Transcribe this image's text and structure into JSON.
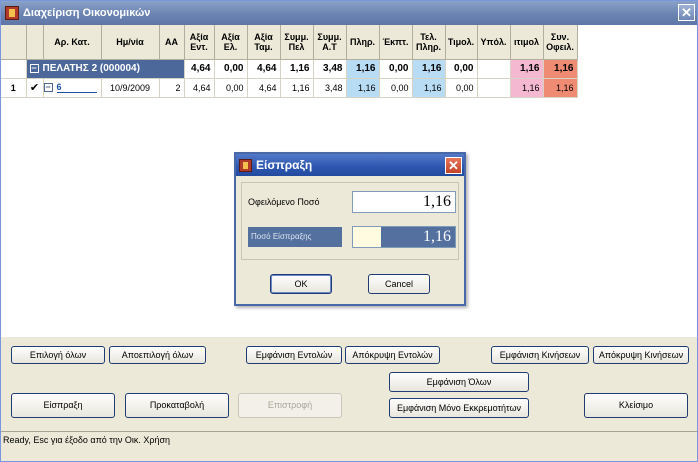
{
  "window": {
    "title": "Διαχείριση Οικονομικών",
    "close_glyph": "✕"
  },
  "grid": {
    "columns": [
      "",
      "",
      "Αρ. Κατ.",
      "Ημ/νία",
      "ΑΑ",
      "Αξία Εντ.",
      "Αξία Ελ.",
      "Αξία Ταμ.",
      "Συμμ. Πελ",
      "Συμμ. Α.Τ",
      "Πληρ.",
      "Έκπτ.",
      "Τελ. Πληρ.",
      "Τιμολ.",
      "Υπόλ.",
      "ιτιμολ",
      "Συν. Οφειλ."
    ],
    "group": {
      "label": "ΠΕΛΑΤΗΣ 2  (000004)",
      "values": [
        "4,64",
        "0,00",
        "4,64",
        "1,16",
        "3,48",
        "1,16",
        "0,00",
        "1,16",
        "0,00",
        "",
        "1,16",
        "1,16"
      ]
    },
    "rows": [
      {
        "num": "1",
        "checked": "✔",
        "code": "6",
        "date": "10/9/2009",
        "aa": "2",
        "values": [
          "4,64",
          "0,00",
          "4,64",
          "1,16",
          "3,48",
          "1,16",
          "0,00",
          "1,16",
          "0,00",
          "",
          "1,16",
          "1,16"
        ]
      }
    ]
  },
  "dialog": {
    "title": "Είσπραξη",
    "owed_label": "Οφειλόμενο Ποσό",
    "owed_value": "1,16",
    "receipt_label": "Ποσό Είσπραξης",
    "receipt_value": "1,16",
    "ok_label": "OK",
    "cancel_label": "Cancel"
  },
  "buttons": {
    "select_all": "Επιλογή όλων",
    "deselect_all": "Αποεπιλογή όλων",
    "show_orders": "Εμφάνιση Εντολών",
    "hide_orders": "Απόκρυψη Εντολών",
    "show_movements": "Εμφάνιση Κινήσεων",
    "hide_movements": "Απόκρυψη Κινήσεων",
    "show_all": "Εμφάνιση Όλων",
    "receipt": "Είσπραξη",
    "advance": "Προκαταβολή",
    "refund": "Επιστροφή",
    "show_pending_only": "Εμφάνιση Μόνο Εκκρεμοτήτων",
    "close": "Κλείσιμο"
  },
  "status": {
    "text": "Ready, Esc για έξοδο από την Οικ. Χρήση"
  },
  "colors": {
    "title_gradient": "#6d86b4",
    "group_row": "#4c689a",
    "blue_col": "#b8dcf4",
    "pink_col": "#f4b8d0",
    "salmon_col": "#ef8a73"
  }
}
